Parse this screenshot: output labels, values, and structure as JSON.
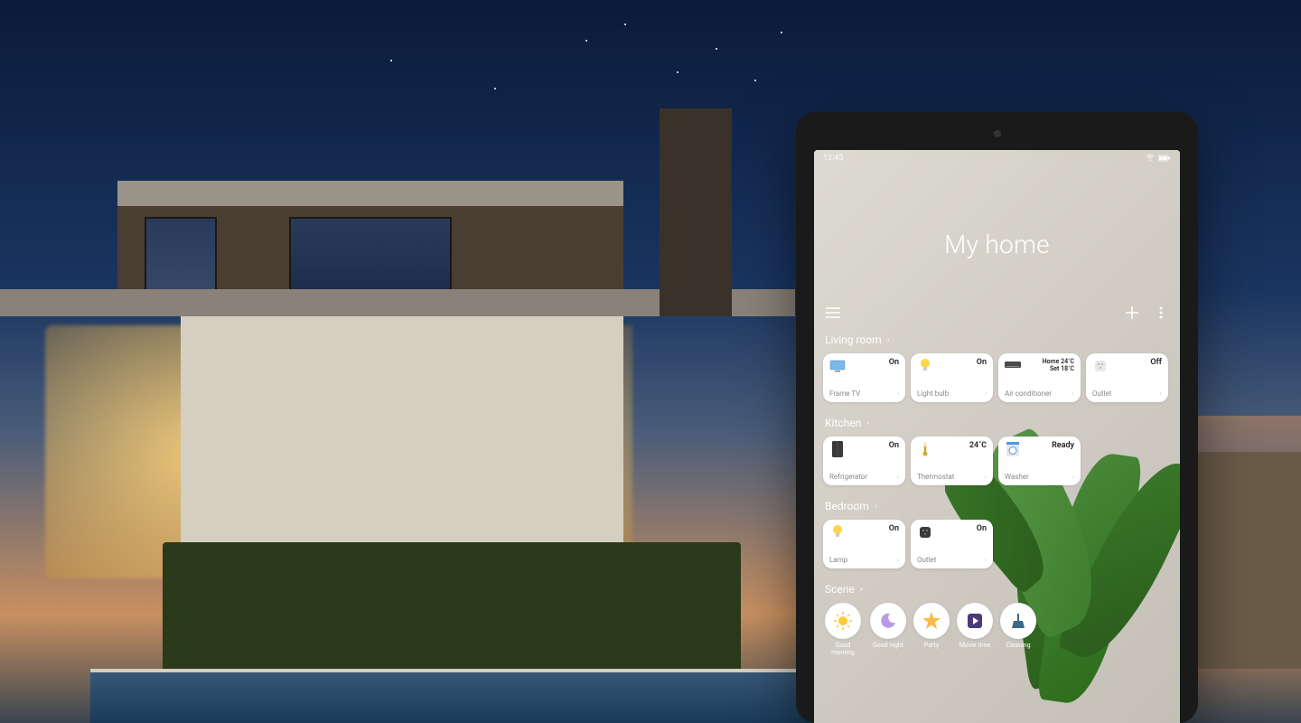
{
  "status_bar": {
    "time": "12:45"
  },
  "page_title": "My home",
  "rooms": [
    {
      "name": "Living room",
      "devices": [
        {
          "icon": "tv",
          "status": "On",
          "label": "Frame TV"
        },
        {
          "icon": "bulb",
          "status": "On",
          "label": "Light bulb"
        },
        {
          "icon": "ac",
          "status_line1": "Home 24˚C",
          "status_line2": "Set 18˚C",
          "label": "Air conditioner"
        },
        {
          "icon": "outlet",
          "status": "Off",
          "label": "Outlet"
        }
      ]
    },
    {
      "name": "Kitchen",
      "devices": [
        {
          "icon": "fridge",
          "status": "On",
          "label": "Refrigerator"
        },
        {
          "icon": "thermo",
          "status": "24˚C",
          "label": "Thermostat"
        },
        {
          "icon": "washer",
          "status": "Ready",
          "label": "Washer"
        }
      ]
    },
    {
      "name": "Bedroom",
      "devices": [
        {
          "icon": "bulb",
          "status": "On",
          "label": "Lamp"
        },
        {
          "icon": "outlet-dark",
          "status": "On",
          "label": "Outlet"
        }
      ]
    }
  ],
  "scenes_label": "Scene",
  "scenes": [
    {
      "icon": "sun",
      "label": "Good morning"
    },
    {
      "icon": "moon",
      "label": "Good night"
    },
    {
      "icon": "star",
      "label": "Party"
    },
    {
      "icon": "movie",
      "label": "Movie time"
    },
    {
      "icon": "clean",
      "label": "Cleaning"
    }
  ]
}
